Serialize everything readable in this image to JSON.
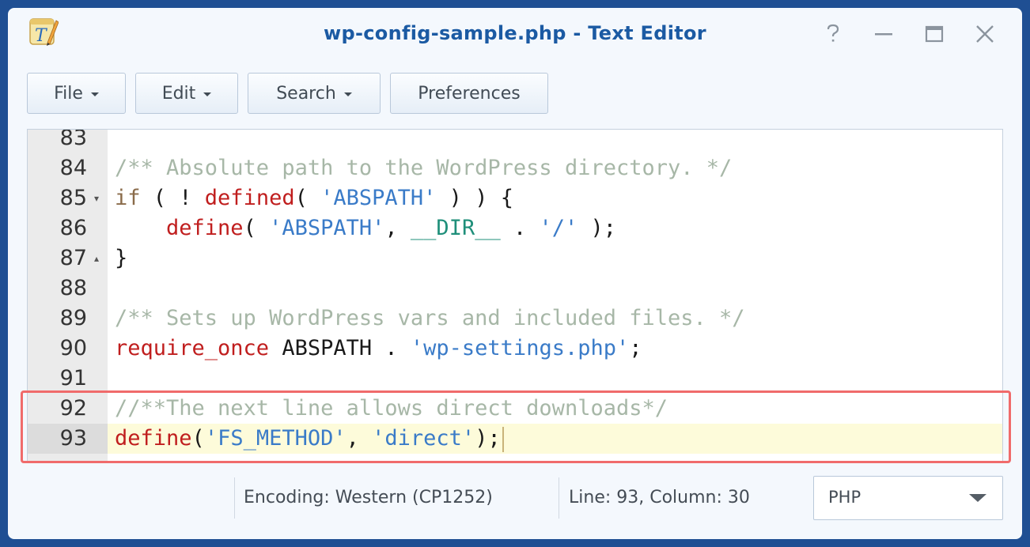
{
  "window": {
    "title": "wp-config-sample.php - Text Editor",
    "controls": {
      "help_icon": "help-icon",
      "minimize_icon": "minimize-icon",
      "maximize_icon": "maximize-icon",
      "close_icon": "close-icon"
    }
  },
  "toolbar": {
    "file_label": "File",
    "edit_label": "Edit",
    "search_label": "Search",
    "preferences_label": "Preferences"
  },
  "editor": {
    "active_line": "93",
    "lines": [
      {
        "number": "83",
        "fold": "",
        "tokens": []
      },
      {
        "number": "84",
        "fold": "",
        "tokens": [
          {
            "t": "/** Absolute path to the WordPress directory. */",
            "c": "cmt"
          }
        ]
      },
      {
        "number": "85",
        "fold": "▾",
        "tokens": [
          {
            "t": "if",
            "c": "kw"
          },
          {
            "t": " ( ! ",
            "c": ""
          },
          {
            "t": "defined",
            "c": "fn"
          },
          {
            "t": "( ",
            "c": ""
          },
          {
            "t": "'ABSPATH'",
            "c": "str"
          },
          {
            "t": " ) ) {",
            "c": ""
          }
        ]
      },
      {
        "number": "86",
        "fold": "",
        "tokens": [
          {
            "t": "    ",
            "c": ""
          },
          {
            "t": "define",
            "c": "fn"
          },
          {
            "t": "( ",
            "c": ""
          },
          {
            "t": "'ABSPATH'",
            "c": "str"
          },
          {
            "t": ", ",
            "c": ""
          },
          {
            "t": "__DIR__",
            "c": "mag"
          },
          {
            "t": " . ",
            "c": ""
          },
          {
            "t": "'/'",
            "c": "str"
          },
          {
            "t": " );",
            "c": ""
          }
        ]
      },
      {
        "number": "87",
        "fold": "▴",
        "tokens": [
          {
            "t": "}",
            "c": ""
          }
        ]
      },
      {
        "number": "88",
        "fold": "",
        "tokens": []
      },
      {
        "number": "89",
        "fold": "",
        "tokens": [
          {
            "t": "/** Sets up WordPress vars and included files. */",
            "c": "cmt"
          }
        ]
      },
      {
        "number": "90",
        "fold": "",
        "tokens": [
          {
            "t": "require_once",
            "c": "fn"
          },
          {
            "t": " ABSPATH . ",
            "c": ""
          },
          {
            "t": "'wp-settings.php'",
            "c": "str"
          },
          {
            "t": ";",
            "c": ""
          }
        ]
      },
      {
        "number": "91",
        "fold": "",
        "tokens": []
      },
      {
        "number": "92",
        "fold": "",
        "tokens": [
          {
            "t": "//**The next line allows direct downloads*/",
            "c": "cmt"
          }
        ]
      },
      {
        "number": "93",
        "fold": "",
        "tokens": [
          {
            "t": "define",
            "c": "fn"
          },
          {
            "t": "(",
            "c": ""
          },
          {
            "t": "'FS_METHOD'",
            "c": "str"
          },
          {
            "t": ", ",
            "c": ""
          },
          {
            "t": "'direct'",
            "c": "str"
          },
          {
            "t": ");",
            "c": ""
          }
        ]
      }
    ]
  },
  "status": {
    "encoding": "Encoding: Western (CP1252)",
    "position": "Line: 93, Column: 30",
    "language": "PHP"
  },
  "colors": {
    "accent": "#1b5aa3",
    "highlight_border": "#f06b6b",
    "comment": "#a7b7a7",
    "function": "#c01e1e",
    "string": "#3a7bc8",
    "keyword": "#8a6b4a",
    "magic_constant": "#1f8f7a"
  }
}
